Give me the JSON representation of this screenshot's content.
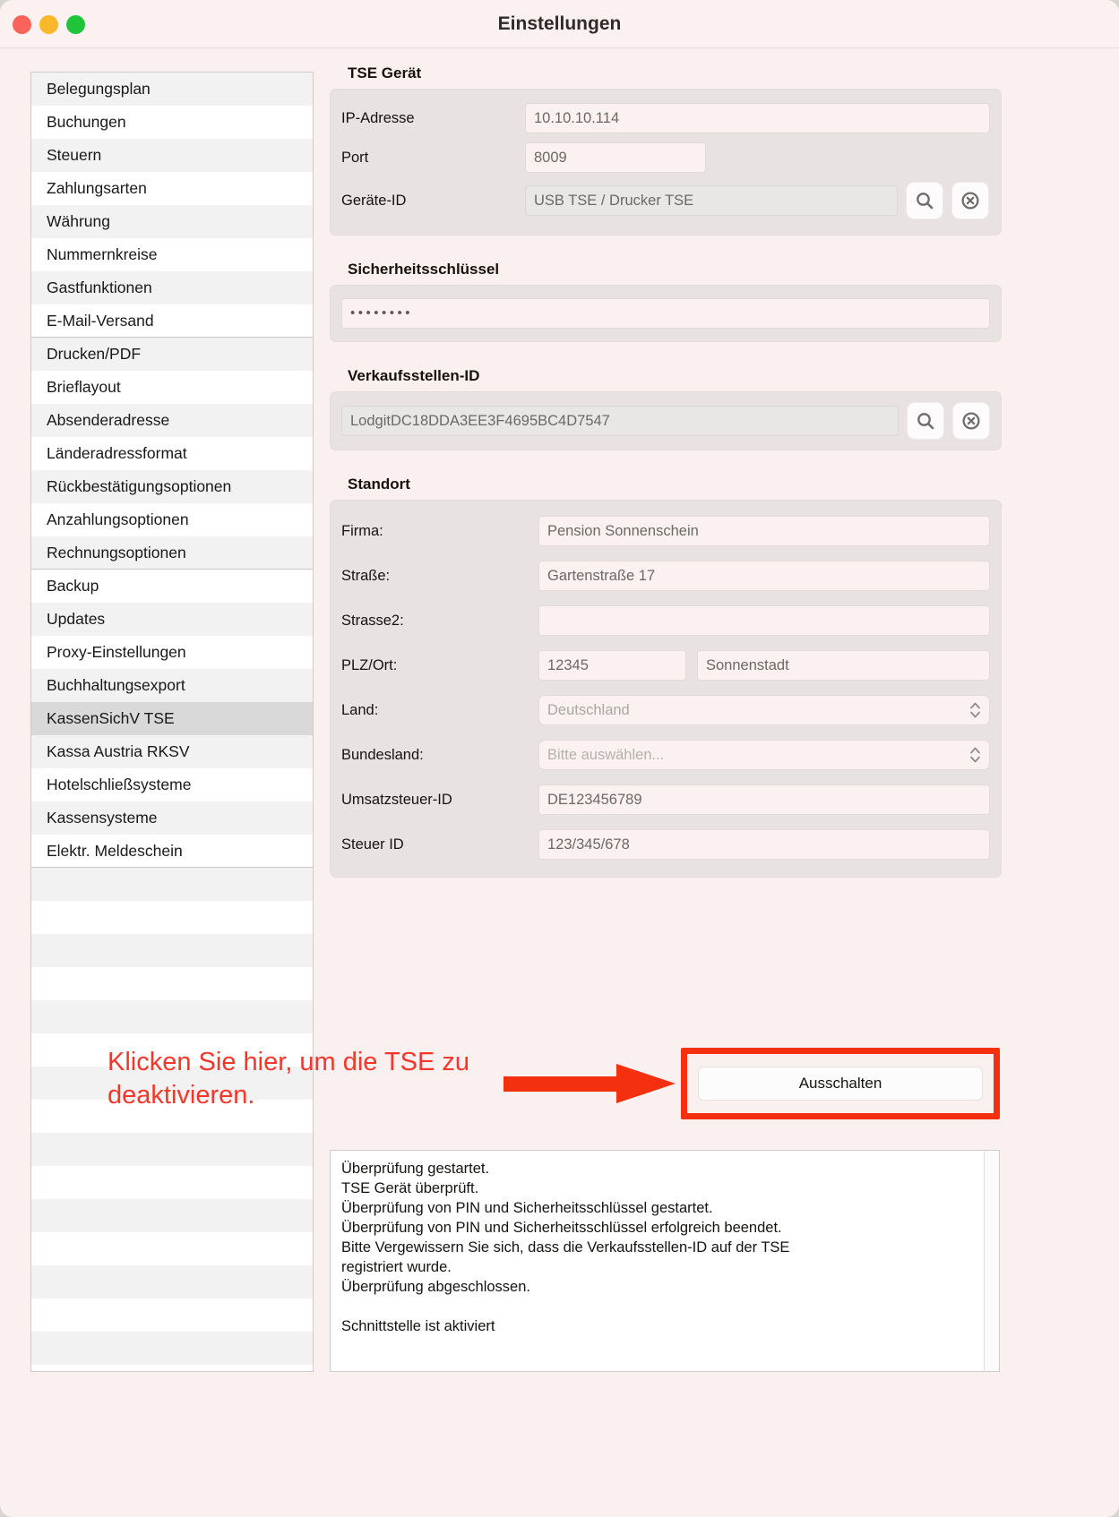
{
  "window": {
    "title": "Einstellungen",
    "traffic_lights": [
      "close",
      "minimize",
      "maximize"
    ]
  },
  "sidebar": {
    "items": [
      {
        "label": "Belegungsplan",
        "selected": false,
        "separator_after": false
      },
      {
        "label": "Buchungen",
        "selected": false,
        "separator_after": false
      },
      {
        "label": "Steuern",
        "selected": false,
        "separator_after": false
      },
      {
        "label": "Zahlungsarten",
        "selected": false,
        "separator_after": false
      },
      {
        "label": "Währung",
        "selected": false,
        "separator_after": false
      },
      {
        "label": "Nummernkreise",
        "selected": false,
        "separator_after": false
      },
      {
        "label": "Gastfunktionen",
        "selected": false,
        "separator_after": false
      },
      {
        "label": "E-Mail-Versand",
        "selected": false,
        "separator_after": true
      },
      {
        "label": "Drucken/PDF",
        "selected": false,
        "separator_after": false
      },
      {
        "label": "Brieflayout",
        "selected": false,
        "separator_after": false
      },
      {
        "label": "Absenderadresse",
        "selected": false,
        "separator_after": false
      },
      {
        "label": "Länderadressformat",
        "selected": false,
        "separator_after": false
      },
      {
        "label": "Rückbestätigungsoptionen",
        "selected": false,
        "separator_after": false
      },
      {
        "label": "Anzahlungsoptionen",
        "selected": false,
        "separator_after": false
      },
      {
        "label": "Rechnungsoptionen",
        "selected": false,
        "separator_after": true
      },
      {
        "label": "Backup",
        "selected": false,
        "separator_after": false
      },
      {
        "label": "Updates",
        "selected": false,
        "separator_after": false
      },
      {
        "label": "Proxy-Einstellungen",
        "selected": false,
        "separator_after": false
      },
      {
        "label": "Buchhaltungsexport",
        "selected": false,
        "separator_after": false
      },
      {
        "label": "KassenSichV TSE",
        "selected": true,
        "separator_after": false
      },
      {
        "label": "Kassa Austria RKSV",
        "selected": false,
        "separator_after": false
      },
      {
        "label": "Hotelschließsysteme",
        "selected": false,
        "separator_after": false
      },
      {
        "label": "Kassensysteme",
        "selected": false,
        "separator_after": false
      },
      {
        "label": "Elektr. Meldeschein",
        "selected": false,
        "separator_after": true
      }
    ],
    "empty_rows": 15
  },
  "tse_device": {
    "group_title": "TSE Gerät",
    "fields": [
      {
        "label": "IP-Adresse",
        "value": "10.10.10.114"
      },
      {
        "label": "Port",
        "value": "8009"
      },
      {
        "label": "Geräte-ID",
        "value": "USB TSE / Drucker TSE"
      }
    ],
    "search_icon": "search-icon",
    "clear_icon": "clear-circle-icon"
  },
  "security_key": {
    "group_title": "Sicherheitsschlüssel",
    "masked_value": "••••••••"
  },
  "pos_id": {
    "group_title": "Verkaufsstellen-ID",
    "value": "LodgitDC18DDA3EE3F4695BC4D7547",
    "search_icon": "search-icon",
    "clear_icon": "clear-circle-icon"
  },
  "location": {
    "group_title": "Standort",
    "fields": [
      {
        "label": "Firma:",
        "value": "Pension Sonnenschein",
        "type": "text"
      },
      {
        "label": "Straße:",
        "value": "Gartenstraße 17",
        "type": "text"
      },
      {
        "label": "Strasse2:",
        "value": "",
        "type": "text"
      },
      {
        "label": "PLZ/Ort:",
        "value": "12345",
        "type": "split",
        "value2": "Sonnenstadt"
      },
      {
        "label": "Land:",
        "value": "Deutschland",
        "type": "select"
      },
      {
        "label": "Bundesland:",
        "value": "Bitte auswählen...",
        "type": "select"
      },
      {
        "label": "Umsatzsteuer-ID",
        "value": "DE123456789",
        "type": "text"
      },
      {
        "label": "Steuer ID",
        "value": "123/345/678",
        "type": "text"
      }
    ]
  },
  "annotation": {
    "text": "Klicken Sie hier, um die TSE zu deaktivieren.",
    "color": "#f4372a",
    "box_color": "#f4300f",
    "arrow_icon": "right-arrow-icon"
  },
  "action": {
    "off_button_label": "Ausschalten"
  },
  "log": {
    "lines": "Überprüfung gestartet.\nTSE Gerät überprüft.\nÜberprüfung von PIN und Sicherheitsschlüssel gestartet.\nÜberprüfung von PIN und Sicherheitsschlüssel erfolgreich beendet.\nBitte Vergewissern Sie sich, dass die Verkaufsstellen-ID auf der TSE\nregistriert wurde.\nÜberprüfung abgeschlossen.\n\nSchnittstelle ist aktiviert"
  }
}
